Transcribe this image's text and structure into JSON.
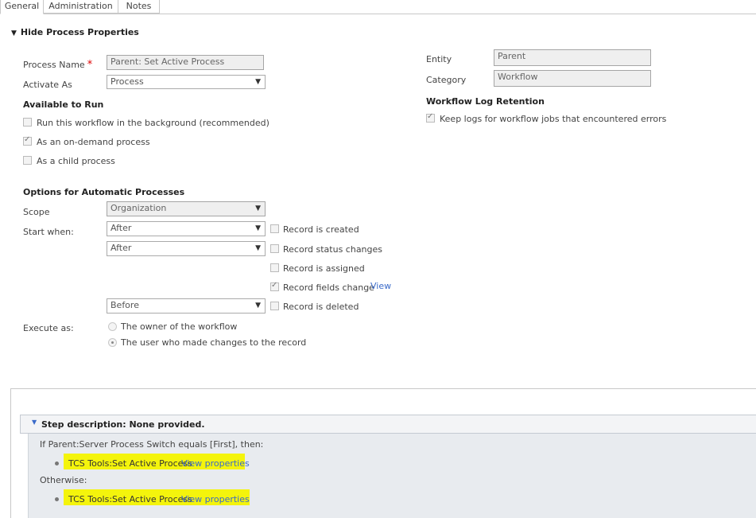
{
  "tabs": [
    "General",
    "Administration",
    "Notes"
  ],
  "section": {
    "toggle_label": "Hide Process Properties"
  },
  "process_name": {
    "label": "Process Name",
    "required_mark": "*",
    "value": "Parent: Set Active Process"
  },
  "activate_as": {
    "label": "Activate As",
    "value": "Process"
  },
  "entity": {
    "label": "Entity",
    "value": "Parent"
  },
  "category": {
    "label": "Category",
    "value": "Workflow"
  },
  "available_to_run": {
    "title": "Available to Run",
    "options": [
      {
        "label": "Run this workflow in the background (recommended)",
        "checked": false
      },
      {
        "label": "As an on-demand process",
        "checked": true
      },
      {
        "label": "As a child process",
        "checked": false
      }
    ]
  },
  "log_retention": {
    "title": "Workflow Log Retention",
    "option": {
      "label": "Keep logs for workflow jobs that encountered errors",
      "checked": true
    }
  },
  "automatic": {
    "title": "Options for Automatic Processes",
    "scope_label": "Scope",
    "scope_value": "Organization",
    "start_when_label": "Start when:",
    "selects": [
      "After",
      "After",
      "Before"
    ],
    "triggers": [
      {
        "label": "Record is created",
        "checked": false
      },
      {
        "label": "Record status changes",
        "checked": false
      },
      {
        "label": "Record is assigned",
        "checked": false
      },
      {
        "label": "Record fields change",
        "checked": true,
        "link": "View"
      },
      {
        "label": "Record is deleted",
        "checked": false
      }
    ],
    "execute_as_label": "Execute as:",
    "execute_options": [
      {
        "label": "The owner of the workflow",
        "checked": false
      },
      {
        "label": "The user who made changes to the record",
        "checked": true
      }
    ]
  },
  "steps": {
    "header": "Step description: None provided.",
    "condition": "If Parent:Server Process Switch equals [First], then:",
    "step1": {
      "text": "TCS Tools:Set Active Process",
      "link": "View properties"
    },
    "otherwise": "Otherwise:",
    "step2": {
      "text": "TCS Tools:Set Active Process",
      "link": "View properties"
    }
  },
  "colors": {
    "highlight": "#f4f40c",
    "link": "#3a6ac9",
    "required": "#d00000"
  }
}
